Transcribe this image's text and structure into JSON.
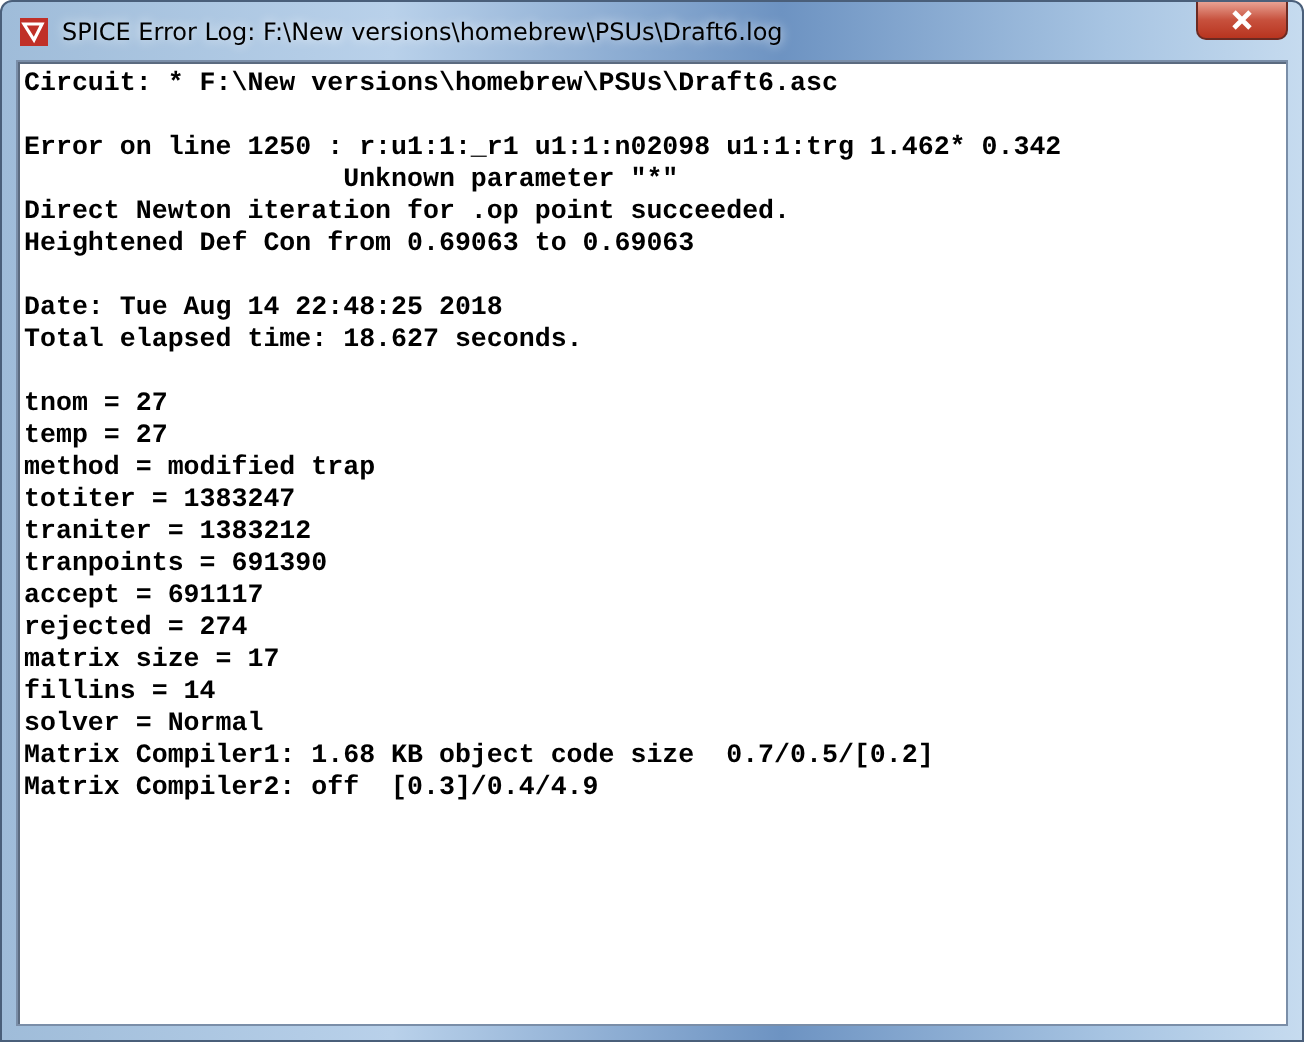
{
  "window": {
    "title": "SPICE Error Log: F:\\New versions\\homebrew\\PSUs\\Draft6.log"
  },
  "log": {
    "blocks": [
      [
        "Circuit: * F:\\New versions\\homebrew\\PSUs\\Draft6.asc"
      ],
      [
        "Error on line 1250 : r:u1:1:_r1 u1:1:n02098 u1:1:trg 1.462* 0.342",
        "                    Unknown parameter \"*\"",
        "Direct Newton iteration for .op point succeeded.",
        "Heightened Def Con from 0.69063 to 0.69063"
      ],
      [
        "Date: Tue Aug 14 22:48:25 2018",
        "Total elapsed time: 18.627 seconds."
      ],
      [
        "tnom = 27",
        "temp = 27",
        "method = modified trap",
        "totiter = 1383247",
        "traniter = 1383212",
        "tranpoints = 691390",
        "accept = 691117",
        "rejected = 274",
        "matrix size = 17",
        "fillins = 14",
        "solver = Normal",
        "Matrix Compiler1: 1.68 KB object code size  0.7/0.5/[0.2]",
        "Matrix Compiler2: off  [0.3]/0.4/4.9"
      ]
    ]
  }
}
